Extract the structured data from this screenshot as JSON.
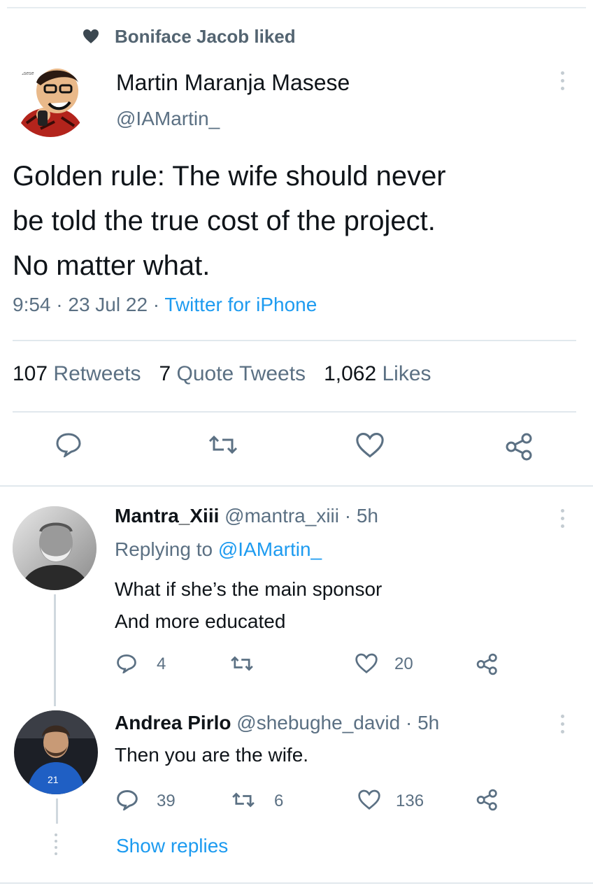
{
  "social_context": {
    "text": "Boniface Jacob liked"
  },
  "tweet": {
    "author_name": "Martin Maranja Masese",
    "author_handle": "@IAMartin_",
    "avatar_label": "Masese",
    "lines": [
      "Golden rule: The wife should never",
      "be told the true cost of the project.",
      "No matter what."
    ],
    "time": "9:54 · 23 Jul 22 ·",
    "source": "Twitter for iPhone",
    "stats": {
      "retweets_count": "107",
      "retweets_label": "Retweets",
      "quotes_count": "7",
      "quotes_label": "Quote Tweets",
      "likes_count": "1,062",
      "likes_label": "Likes"
    }
  },
  "replies": [
    {
      "name": "Mantra_Xiii",
      "handle_time": "@mantra_xiii · 5h",
      "replying_prefix": "Replying to",
      "replying_handle": "@IAMartin_",
      "lines": [
        "What if she’s the main sponsor",
        "And more educated"
      ],
      "reply_count": "4",
      "retweet_count": "",
      "like_count": "20"
    },
    {
      "name": "Andrea Pirlo",
      "handle_time": "@shebughe_david · 5h",
      "lines": [
        "Then you are the wife."
      ],
      "reply_count": "39",
      "retweet_count": "6",
      "like_count": "136",
      "jersey_number": "21"
    }
  ],
  "show_replies": "Show replies",
  "colors": {
    "accent": "#1d9bf0",
    "muted": "#5b7083",
    "text": "#0f1419"
  }
}
